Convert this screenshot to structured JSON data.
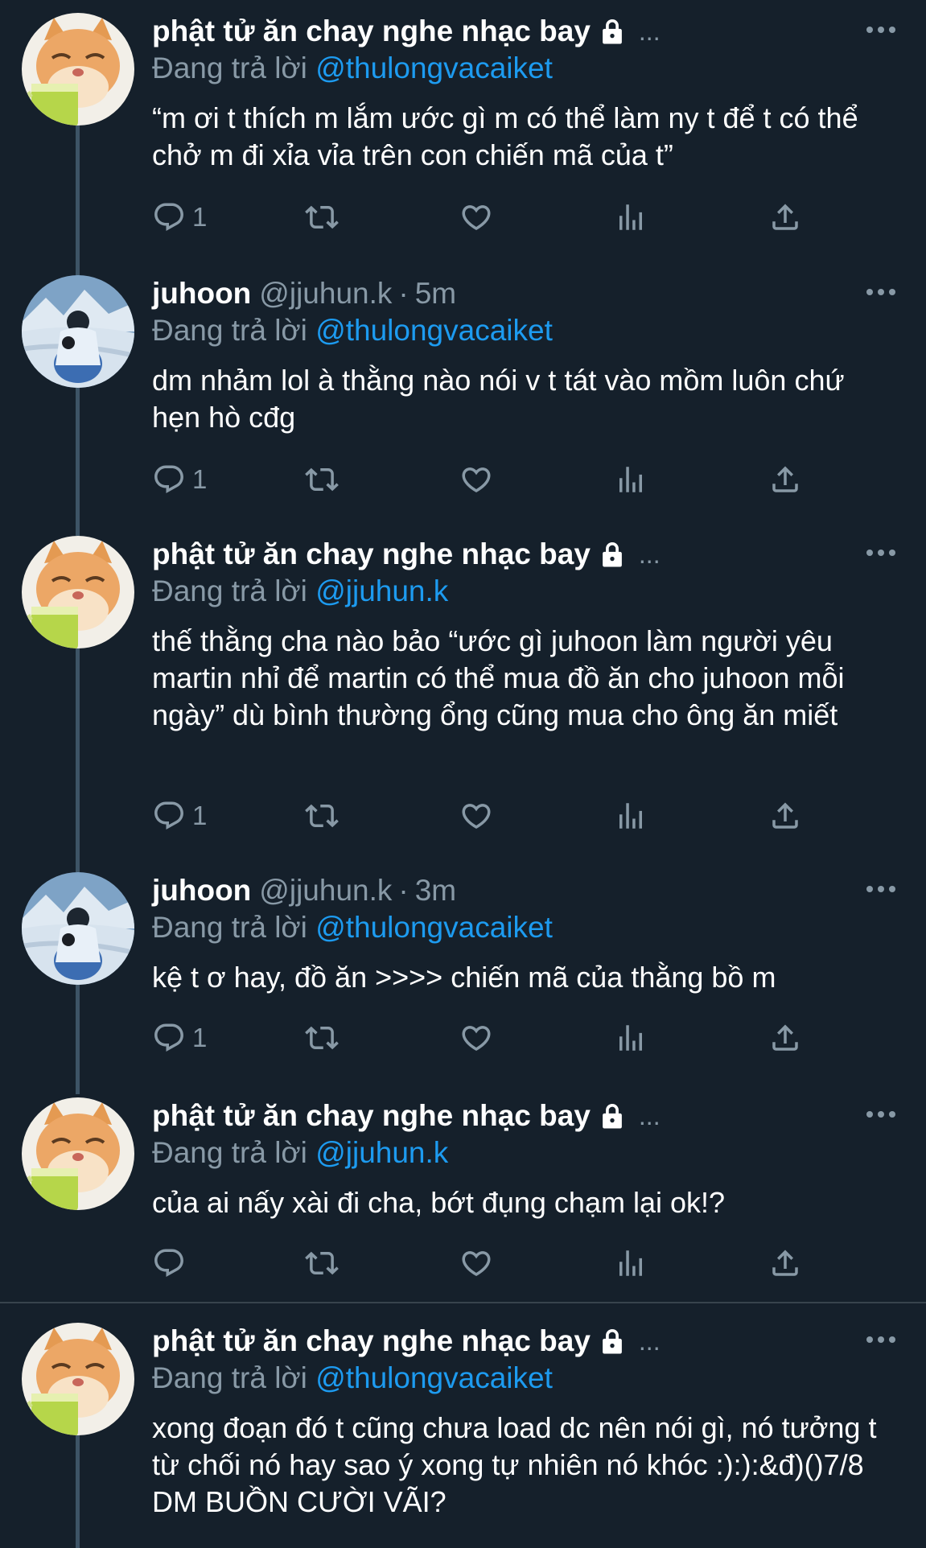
{
  "reply_prefix": "Đang trả lời ",
  "ellipsis": "...",
  "colors": {
    "background": "#15202b",
    "secondary_text": "#8899a6",
    "mention": "#1d9bf0",
    "thread_line": "#3d5466"
  },
  "icons": {
    "reply": "reply-icon",
    "retweet": "retweet-icon",
    "like": "heart-icon",
    "views": "views-icon",
    "share": "share-icon",
    "more": "more-icon",
    "lock": "lock-icon"
  },
  "tweets": [
    {
      "name": "phật tử ăn chay nghe nhạc bay",
      "replying_to": "@thulongvacaiket",
      "text": "“m ơi t thích m lắm ước gì m có thể làm ny t để t có thể chở m đi xỉa vỉa trên con chiến mã của t”",
      "reply_count": "1"
    },
    {
      "name": "juhoon",
      "handle": "@jjuhun.k",
      "time": "5m",
      "replying_to": "@thulongvacaiket",
      "text": "dm nhảm lol à thằng nào nói v t tát vào mồm luôn chứ hẹn hò cđg",
      "reply_count": "1"
    },
    {
      "name": "phật tử ăn chay nghe nhạc bay",
      "replying_to": "@jjuhun.k",
      "text": "thế thằng cha nào bảo “ước gì juhoon làm người yêu martin nhỉ để martin có thể mua đồ ăn cho juhoon mỗi ngày” dù bình thường ổng cũng mua cho ông ăn miết",
      "reply_count": "1"
    },
    {
      "name": "juhoon",
      "handle": "@jjuhun.k",
      "time": "3m",
      "replying_to": "@thulongvacaiket",
      "text": "kệ t ơ hay, đồ ăn >>>> chiến mã của thằng bồ m",
      "reply_count": "1"
    },
    {
      "name": "phật tử ăn chay nghe nhạc bay",
      "replying_to": "@jjuhun.k",
      "text": "của ai nấy xài đi cha, bớt đụng chạm lại ok!?",
      "reply_count": ""
    },
    {
      "name": "phật tử ăn chay nghe nhạc bay",
      "replying_to": "@thulongvacaiket",
      "text": "xong đoạn đó t cũng chưa load dc nên nói gì, nó tưởng t từ chối nó hay sao ý xong tự nhiên nó khóc :):):&đ)()7/8 DM BUỒN CƯỜI VÃI?"
    }
  ]
}
